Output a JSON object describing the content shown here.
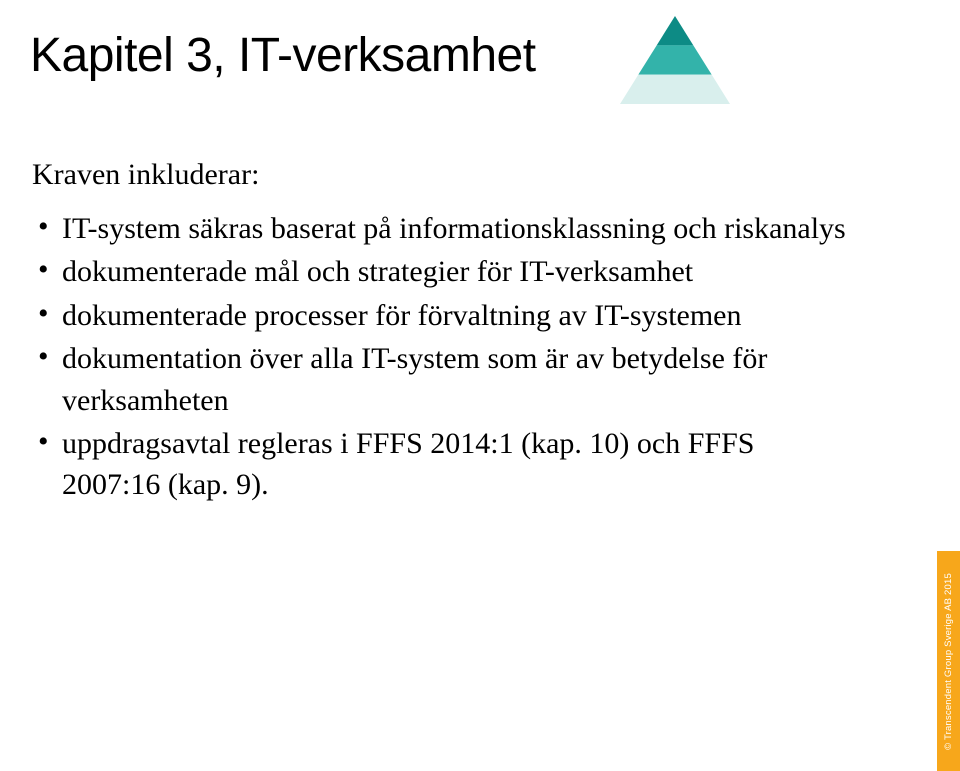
{
  "title": "Kapitel 3, IT-verksamhet",
  "subheading": "Kraven inkluderar:",
  "bullets": [
    "IT-system säkras baserat på informationsklassning och riskanalys",
    "dokumenterade mål och strategier för IT-verksamhet",
    "dokumenterade processer för förvaltning av IT-systemen",
    "dokumentation över alla IT-system som är av betydelse för verksamheten",
    "uppdragsavtal regleras i FFFS 2014:1 (kap. 10) och FFFS 2007:16 (kap. 9)."
  ],
  "side_tab": "© Transcendent Group Sverige AB 2015",
  "pyramid_colors": {
    "top": "#0d8b85",
    "middle": "#33b3aa",
    "bottom": "#d9efed"
  }
}
